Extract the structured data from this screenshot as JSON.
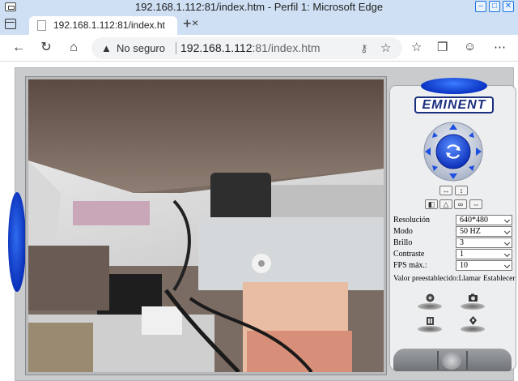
{
  "window": {
    "title": "192.168.1.112:81/index.htm - Perfil 1: Microsoft Edge"
  },
  "tab": {
    "title": "192.168.1.112:81/index.htm"
  },
  "address_bar": {
    "security_label": "No seguro",
    "url_host": "192.168.1.112",
    "url_port_path": ":81/index.htm"
  },
  "camera_panel": {
    "brand": "EMINENT",
    "settings": [
      {
        "label": "Resolución",
        "value": "640*480"
      },
      {
        "label": "Modo",
        "value": "50 HZ"
      },
      {
        "label": "Brillo",
        "value": "3"
      },
      {
        "label": "Contraste",
        "value": "1"
      },
      {
        "label": "FPS máx.:",
        "value": "10"
      }
    ],
    "preset_label": "Valor preestablecido:Llamar",
    "preset_set_label": "Establecer"
  },
  "icons": {
    "window_minimize": "minimize-icon",
    "window_maximize": "maximize-icon",
    "window_close": "close-icon"
  },
  "colors": {
    "accent_blue": "#0b34c4",
    "logo_navy": "#1b2f80",
    "tab_strip": "#cfe0f4"
  }
}
